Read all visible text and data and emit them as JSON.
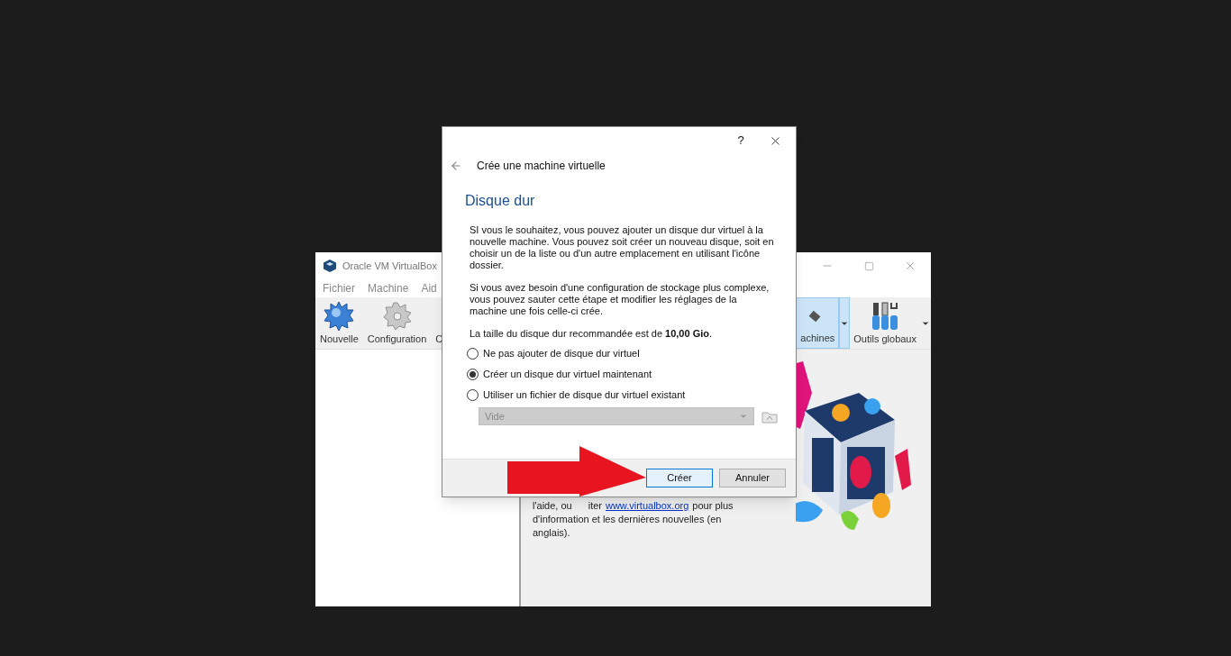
{
  "main_window": {
    "title": "Oracle VM VirtualBox",
    "menu": [
      "Fichier",
      "Machine",
      "Aid"
    ],
    "toolbar_left": [
      {
        "label": "Nouvelle",
        "kind": "new"
      },
      {
        "label": "Configuration",
        "kind": "settings"
      },
      {
        "label": "C",
        "kind": "cut"
      }
    ],
    "toolbar_right": [
      {
        "label": "achines",
        "kind": "machines",
        "selected": true
      },
      {
        "label": "Outils globaux",
        "kind": "tools",
        "selected": false
      }
    ],
    "welcome": {
      "before": "l'aide, ou",
      "after": "iter",
      "link": "www.virtualbox.org",
      "rest": "pour plus",
      "lines": [
        "d'information et les dernières nouvelles (en",
        "anglais)."
      ]
    }
  },
  "dialog": {
    "help": "?",
    "wizard_title": "Crée une machine virtuelle",
    "heading": "Disque dur",
    "paragraphs": [
      "SI vous le souhaitez, vous pouvez ajouter un disque dur virtuel à la nouvelle machine. Vous pouvez soit créer un nouveau disque, soit en choisir un de la liste ou d'un autre emplacement en utilisant l'icône dossier.",
      "Si vous avez besoin d'une configuration de stockage plus complexe, vous pouvez sauter cette étape et modifier les réglages de la machine une fois celle-ci crée.",
      "La taille du disque dur recommandée est de **10,00 Gio**."
    ],
    "options": [
      {
        "label": "Ne pas ajouter de disque dur virtuel",
        "selected": false
      },
      {
        "label": "Créer un disque dur virtuel maintenant",
        "selected": true
      },
      {
        "label": "Utiliser un fichier de disque dur virtuel existant",
        "selected": false
      }
    ],
    "file_select": {
      "value": "Vide",
      "disabled": true
    },
    "buttons": [
      {
        "label": "Créer",
        "default": true
      },
      {
        "label": "Annuler",
        "default": false
      }
    ]
  }
}
